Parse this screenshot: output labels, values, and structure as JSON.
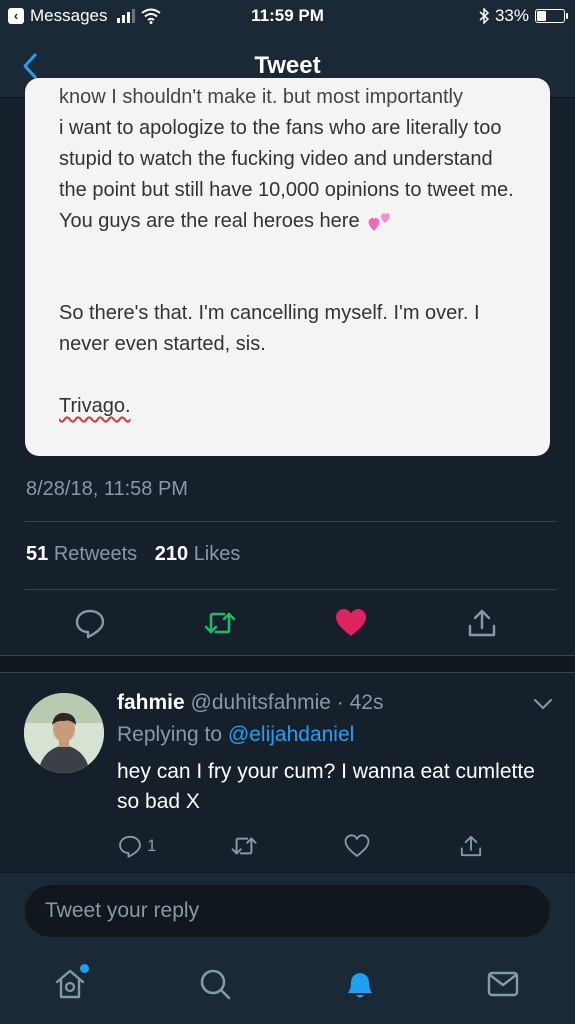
{
  "status_bar": {
    "back_app_label": "Messages",
    "time": "11:59 PM",
    "battery_percent": "33%",
    "battery_level": 0.33,
    "signal_bars": 3,
    "icons": [
      "signal-icon",
      "wifi-icon",
      "bluetooth-icon",
      "battery-icon"
    ]
  },
  "nav": {
    "title": "Tweet",
    "back_icon": "chevron-left-icon"
  },
  "tweet": {
    "image_text": {
      "cut_line": "know I shouldn't make it. but most importantly",
      "paragraph1": "i want to apologize to the fans who are literally too stupid to watch the fucking video and understand the point but still have 10,000 opinions to tweet me. You guys are the real heroes here",
      "paragraph1_emoji": "two-hearts-icon",
      "paragraph2": "So there's that. I'm cancelling myself. I'm over. I never even started, sis.",
      "paragraph3": "Trivago."
    },
    "timestamp": "8/28/18, 11:58 PM",
    "retweets_count": "51",
    "retweets_label": "Retweets",
    "likes_count": "210",
    "likes_label": "Likes",
    "actions": [
      "reply-icon",
      "retweet-icon",
      "like-icon",
      "share-icon"
    ],
    "colors": {
      "retweet": "#17bf63",
      "like": "#e0245e"
    }
  },
  "reply": {
    "name": "fahmie",
    "handle_time": "@duhitsfahmie · 42s",
    "replying_prefix": "Replying to",
    "replying_to": "@elijahdaniel",
    "text": "hey can I fry your cum? I wanna eat cumlette so bad X",
    "reply_count": "1"
  },
  "composer": {
    "placeholder": "Tweet your reply"
  },
  "tabs": [
    "home-icon",
    "search-icon",
    "notifications-icon",
    "messages-icon"
  ],
  "colors": {
    "background": "#15202b",
    "accent": "#1da1f2",
    "secondary_text": "#8899a6"
  }
}
